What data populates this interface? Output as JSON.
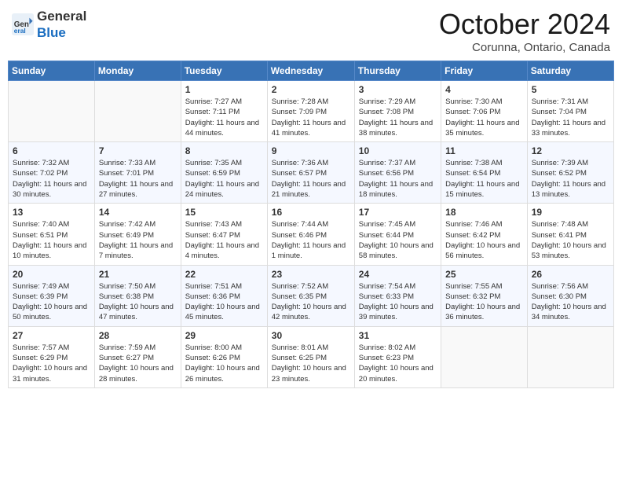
{
  "logo": {
    "general": "General",
    "blue": "Blue"
  },
  "header": {
    "month": "October 2024",
    "location": "Corunna, Ontario, Canada"
  },
  "days_of_week": [
    "Sunday",
    "Monday",
    "Tuesday",
    "Wednesday",
    "Thursday",
    "Friday",
    "Saturday"
  ],
  "weeks": [
    [
      {
        "num": "",
        "info": ""
      },
      {
        "num": "",
        "info": ""
      },
      {
        "num": "1",
        "info": "Sunrise: 7:27 AM\nSunset: 7:11 PM\nDaylight: 11 hours and 44 minutes."
      },
      {
        "num": "2",
        "info": "Sunrise: 7:28 AM\nSunset: 7:09 PM\nDaylight: 11 hours and 41 minutes."
      },
      {
        "num": "3",
        "info": "Sunrise: 7:29 AM\nSunset: 7:08 PM\nDaylight: 11 hours and 38 minutes."
      },
      {
        "num": "4",
        "info": "Sunrise: 7:30 AM\nSunset: 7:06 PM\nDaylight: 11 hours and 35 minutes."
      },
      {
        "num": "5",
        "info": "Sunrise: 7:31 AM\nSunset: 7:04 PM\nDaylight: 11 hours and 33 minutes."
      }
    ],
    [
      {
        "num": "6",
        "info": "Sunrise: 7:32 AM\nSunset: 7:02 PM\nDaylight: 11 hours and 30 minutes."
      },
      {
        "num": "7",
        "info": "Sunrise: 7:33 AM\nSunset: 7:01 PM\nDaylight: 11 hours and 27 minutes."
      },
      {
        "num": "8",
        "info": "Sunrise: 7:35 AM\nSunset: 6:59 PM\nDaylight: 11 hours and 24 minutes."
      },
      {
        "num": "9",
        "info": "Sunrise: 7:36 AM\nSunset: 6:57 PM\nDaylight: 11 hours and 21 minutes."
      },
      {
        "num": "10",
        "info": "Sunrise: 7:37 AM\nSunset: 6:56 PM\nDaylight: 11 hours and 18 minutes."
      },
      {
        "num": "11",
        "info": "Sunrise: 7:38 AM\nSunset: 6:54 PM\nDaylight: 11 hours and 15 minutes."
      },
      {
        "num": "12",
        "info": "Sunrise: 7:39 AM\nSunset: 6:52 PM\nDaylight: 11 hours and 13 minutes."
      }
    ],
    [
      {
        "num": "13",
        "info": "Sunrise: 7:40 AM\nSunset: 6:51 PM\nDaylight: 11 hours and 10 minutes."
      },
      {
        "num": "14",
        "info": "Sunrise: 7:42 AM\nSunset: 6:49 PM\nDaylight: 11 hours and 7 minutes."
      },
      {
        "num": "15",
        "info": "Sunrise: 7:43 AM\nSunset: 6:47 PM\nDaylight: 11 hours and 4 minutes."
      },
      {
        "num": "16",
        "info": "Sunrise: 7:44 AM\nSunset: 6:46 PM\nDaylight: 11 hours and 1 minute."
      },
      {
        "num": "17",
        "info": "Sunrise: 7:45 AM\nSunset: 6:44 PM\nDaylight: 10 hours and 58 minutes."
      },
      {
        "num": "18",
        "info": "Sunrise: 7:46 AM\nSunset: 6:42 PM\nDaylight: 10 hours and 56 minutes."
      },
      {
        "num": "19",
        "info": "Sunrise: 7:48 AM\nSunset: 6:41 PM\nDaylight: 10 hours and 53 minutes."
      }
    ],
    [
      {
        "num": "20",
        "info": "Sunrise: 7:49 AM\nSunset: 6:39 PM\nDaylight: 10 hours and 50 minutes."
      },
      {
        "num": "21",
        "info": "Sunrise: 7:50 AM\nSunset: 6:38 PM\nDaylight: 10 hours and 47 minutes."
      },
      {
        "num": "22",
        "info": "Sunrise: 7:51 AM\nSunset: 6:36 PM\nDaylight: 10 hours and 45 minutes."
      },
      {
        "num": "23",
        "info": "Sunrise: 7:52 AM\nSunset: 6:35 PM\nDaylight: 10 hours and 42 minutes."
      },
      {
        "num": "24",
        "info": "Sunrise: 7:54 AM\nSunset: 6:33 PM\nDaylight: 10 hours and 39 minutes."
      },
      {
        "num": "25",
        "info": "Sunrise: 7:55 AM\nSunset: 6:32 PM\nDaylight: 10 hours and 36 minutes."
      },
      {
        "num": "26",
        "info": "Sunrise: 7:56 AM\nSunset: 6:30 PM\nDaylight: 10 hours and 34 minutes."
      }
    ],
    [
      {
        "num": "27",
        "info": "Sunrise: 7:57 AM\nSunset: 6:29 PM\nDaylight: 10 hours and 31 minutes."
      },
      {
        "num": "28",
        "info": "Sunrise: 7:59 AM\nSunset: 6:27 PM\nDaylight: 10 hours and 28 minutes."
      },
      {
        "num": "29",
        "info": "Sunrise: 8:00 AM\nSunset: 6:26 PM\nDaylight: 10 hours and 26 minutes."
      },
      {
        "num": "30",
        "info": "Sunrise: 8:01 AM\nSunset: 6:25 PM\nDaylight: 10 hours and 23 minutes."
      },
      {
        "num": "31",
        "info": "Sunrise: 8:02 AM\nSunset: 6:23 PM\nDaylight: 10 hours and 20 minutes."
      },
      {
        "num": "",
        "info": ""
      },
      {
        "num": "",
        "info": ""
      }
    ]
  ]
}
